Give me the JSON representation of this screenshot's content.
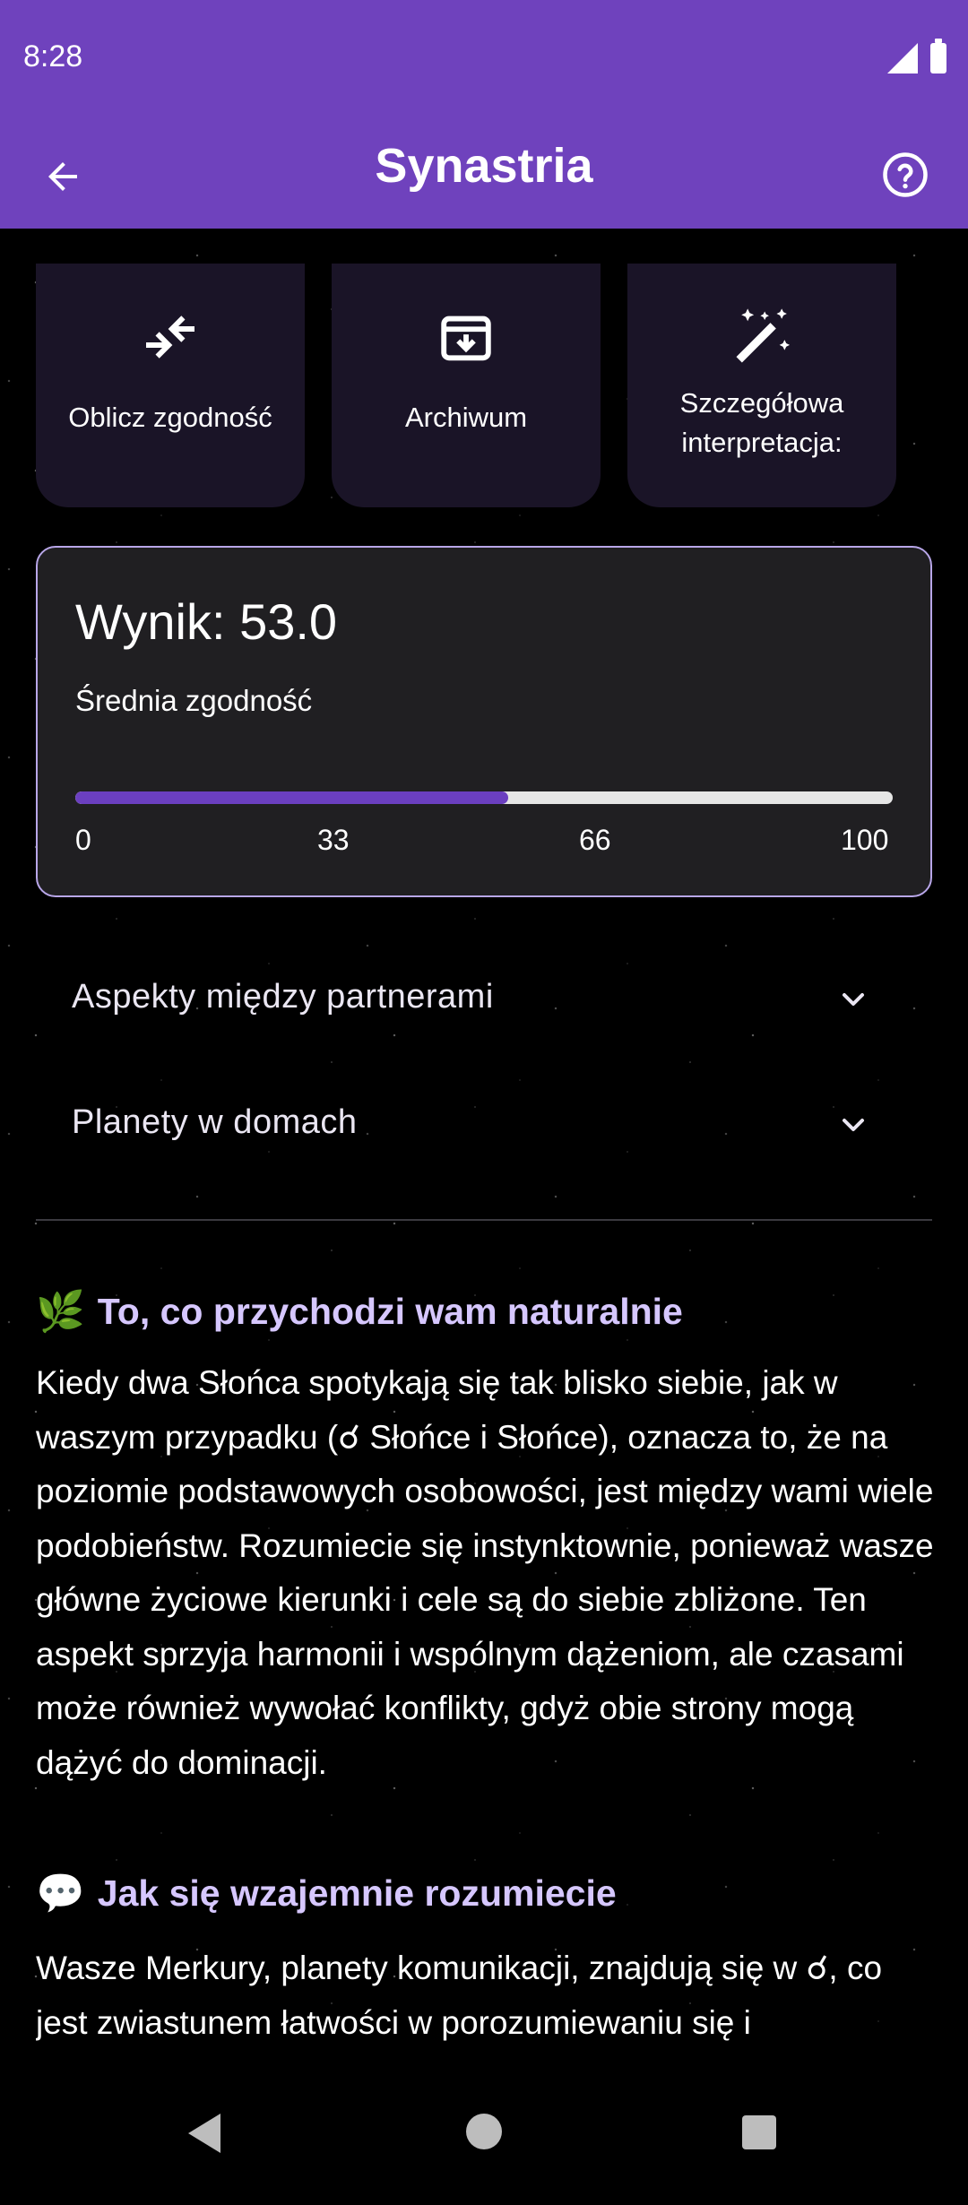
{
  "status_bar": {
    "time": "8:28"
  },
  "app_bar": {
    "title": "Synastria"
  },
  "actions": [
    {
      "label": "Oblicz zgodność",
      "icon": "compare-arrows-icon"
    },
    {
      "label": "Archiwum",
      "icon": "archive-icon"
    },
    {
      "label": "Szczegółowa interpretacja:",
      "icon": "magic-wand-icon"
    }
  ],
  "score": {
    "title": "Wynik: 53.0",
    "subtitle": "Średnia zgodność",
    "progress_percent": 53,
    "ticks": [
      "0",
      "33",
      "66",
      "100"
    ]
  },
  "accordions": [
    {
      "label": "Aspekty między partnerami"
    },
    {
      "label": "Planety w domach"
    }
  ],
  "sections": [
    {
      "emoji": "🌿",
      "heading": "To, co przychodzi wam naturalnie",
      "body": "Kiedy dwa Słońca spotykają się tak blisko siebie, jak w waszym przypadku (☌ Słońce i Słońce), oznacza to, że na poziomie podstawowych osobowości, jest między wami wiele podobieństw. Rozumiecie się instynktownie, ponieważ wasze główne życiowe kierunki i cele są do siebie zbliżone. Ten aspekt sprzyja harmonii i wspólnym dążeniom, ale czasami może również wywołać konflikty, gdyż obie strony mogą dążyć do dominacji."
    },
    {
      "emoji": "💬",
      "heading": "Jak się wzajemnie rozumiecie",
      "body": "Wasze Merkury, planety komunikacji, znajdują się w ☌, co jest zwiastunem łatwości w porozumiewaniu się i"
    }
  ],
  "colors": {
    "primary": "#6f42bd",
    "card_bg": "#1a1427",
    "score_border": "#b8a6e8",
    "heading": "#d6c7ff"
  }
}
